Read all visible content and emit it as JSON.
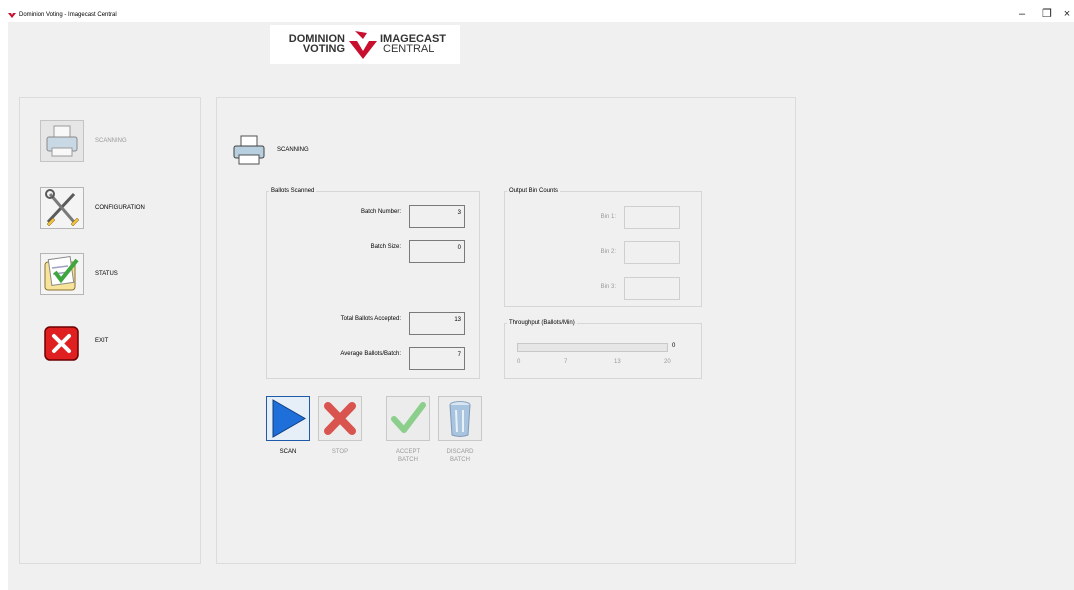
{
  "window": {
    "title": "Dominion Voting - Imagecast Central",
    "controls": {
      "minimize": "–",
      "restore": "❐",
      "close": "×"
    }
  },
  "logo": {
    "line1_left": "DOMINION",
    "line2_left": "VOTING",
    "line1_right": "IMAGECAST",
    "line2_right": "CENTRAL"
  },
  "sidebar": {
    "items": [
      {
        "label": "SCANNING",
        "icon": "printer-icon",
        "enabled": false
      },
      {
        "label": "CONFIGURATION",
        "icon": "tools-icon",
        "enabled": true
      },
      {
        "label": "STATUS",
        "icon": "checklist-icon",
        "enabled": true
      },
      {
        "label": "EXIT",
        "icon": "close-icon",
        "enabled": true
      }
    ]
  },
  "main": {
    "title": "SCANNING",
    "ballots_scanned": {
      "title": "Ballots Scanned",
      "batch_number_label": "Batch Number:",
      "batch_number_value": "3",
      "batch_size_label": "Batch Size:",
      "batch_size_value": "0",
      "total_accepted_label": "Total Ballots Accepted:",
      "total_accepted_value": "13",
      "average_label": "Average Ballots/Batch:",
      "average_value": "7"
    },
    "output_bins": {
      "title": "Output Bin Counts",
      "bin1_label": "Bin 1:",
      "bin2_label": "Bin 2:",
      "bin3_label": "Bin 3:"
    },
    "throughput": {
      "title": "Throughput (Ballots/Min)",
      "value": "0",
      "fill_fraction": 0,
      "ticks": [
        "0",
        "7",
        "13",
        "20"
      ]
    },
    "buttons": {
      "scan": "SCAN",
      "stop": "STOP",
      "accept_line1": "ACCEPT",
      "accept_line2": "BATCH",
      "discard_line1": "DISCARD",
      "discard_line2": "BATCH"
    }
  },
  "colors": {
    "background": "#f0f0f0",
    "scan_blue": "#1e6fd9",
    "stop_red": "#d9534f",
    "accept_green": "#5cb85c",
    "exit_red": "#e02020",
    "brand_red": "#c8102e"
  }
}
